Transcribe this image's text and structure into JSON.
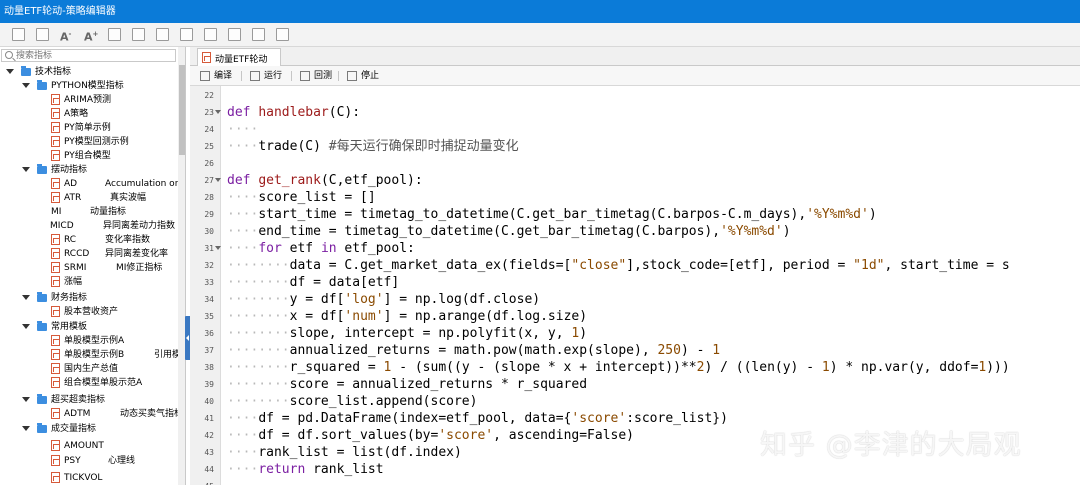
{
  "window": {
    "title": "动量ETF轮动-策略编辑器"
  },
  "toolbar": {
    "icons": [
      "save-icon",
      "save-as-icon",
      "font-decrease-icon",
      "font-increase-icon",
      "copy-icon",
      "paste-icon",
      "undo-icon",
      "redo-icon",
      "import-icon",
      "export-icon",
      "print-icon",
      "help-icon"
    ],
    "font_small_label": "A",
    "font_small_sup": "-",
    "font_big_label": "A",
    "font_big_sup": "+"
  },
  "sidebar": {
    "search": {
      "placeholder": "搜索指标"
    },
    "tree": [
      {
        "label": "技术指标"
      },
      {
        "label": "PYTHON模型指标"
      },
      {
        "label": "ARIMA预测"
      },
      {
        "label": "A策略"
      },
      {
        "label": "PY简单示例"
      },
      {
        "label": "PY模型回测示例"
      },
      {
        "label": "PY组合模型"
      },
      {
        "label": "摆动指标"
      },
      {
        "label": "AD",
        "extra": "Accumulation or"
      },
      {
        "label": "ATR",
        "extra": "真实波幅"
      },
      {
        "label": "MI",
        "extra": "动量指标"
      },
      {
        "label": "MICD",
        "extra": "异同离差动力指数"
      },
      {
        "label": "RC",
        "extra": "变化率指数"
      },
      {
        "label": "RCCD",
        "extra": "异同离差变化率"
      },
      {
        "label": "SRMI",
        "extra": "MI修正指标"
      },
      {
        "label": "涨幅"
      },
      {
        "label": "财务指标"
      },
      {
        "label": "股本营收资产"
      },
      {
        "label": "常用模板"
      },
      {
        "label": "单股模型示例A"
      },
      {
        "label": "单股模型示例B",
        "extra": "引用模"
      },
      {
        "label": "国内生产总值"
      },
      {
        "label": "组合模型单股示范A"
      },
      {
        "label": "超买超卖指标"
      },
      {
        "label": "ADTM",
        "extra": "动态买卖气指标"
      },
      {
        "label": "成交量指标"
      },
      {
        "label": "AMOUNT"
      },
      {
        "label": "PSY",
        "extra": "心理线"
      },
      {
        "label": "TICKVOL"
      }
    ]
  },
  "editor": {
    "tab_label": "动量ETF轮动",
    "actions": {
      "compile": "编译",
      "run": "运行",
      "backtest": "回测",
      "stop": "停止"
    },
    "lines": [
      {
        "num": "22",
        "text": ""
      },
      {
        "num": "23",
        "text": "def handlebar(C):"
      },
      {
        "num": "24",
        "text": "····"
      },
      {
        "num": "25",
        "text": "····trade(C) #每天运行确保即时捕捉动量变化"
      },
      {
        "num": "26",
        "text": ""
      },
      {
        "num": "27",
        "text": "def get_rank(C,etf_pool):"
      },
      {
        "num": "28",
        "text": "····score_list = []"
      },
      {
        "num": "29",
        "text": "····start_time = timetag_to_datetime(C.get_bar_timetag(C.barpos-C.m_days),'%Y%m%d')"
      },
      {
        "num": "30",
        "text": "····end_time = timetag_to_datetime(C.get_bar_timetag(C.barpos),'%Y%m%d')"
      },
      {
        "num": "31",
        "text": "····for etf in etf_pool:"
      },
      {
        "num": "32",
        "text": "········data = C.get_market_data_ex(fields=[\"close\"],stock_code=[etf], period = \"1d\", start_time = s"
      },
      {
        "num": "33",
        "text": "········df = data[etf]"
      },
      {
        "num": "34",
        "text": "········y = df['log'] = np.log(df.close)"
      },
      {
        "num": "35",
        "text": "········x = df['num'] = np.arange(df.log.size)"
      },
      {
        "num": "36",
        "text": "········slope, intercept = np.polyfit(x, y, 1)"
      },
      {
        "num": "37",
        "text": "········annualized_returns = math.pow(math.exp(slope), 250) - 1"
      },
      {
        "num": "38",
        "text": "········r_squared = 1 - (sum((y - (slope * x + intercept))**2) / ((len(y) - 1) * np.var(y, ddof=1)))"
      },
      {
        "num": "39",
        "text": "········score = annualized_returns * r_squared"
      },
      {
        "num": "40",
        "text": "········score_list.append(score)"
      },
      {
        "num": "41",
        "text": "····df = pd.DataFrame(index=etf_pool, data={'score':score_list})"
      },
      {
        "num": "42",
        "text": "····df = df.sort_values(by='score', ascending=False)"
      },
      {
        "num": "43",
        "text": "····rank_list = list(df.index)"
      },
      {
        "num": "44",
        "text": "····return rank_list"
      },
      {
        "num": "45",
        "text": ""
      }
    ]
  },
  "watermark": {
    "text": "知乎 @李津的大局观"
  }
}
